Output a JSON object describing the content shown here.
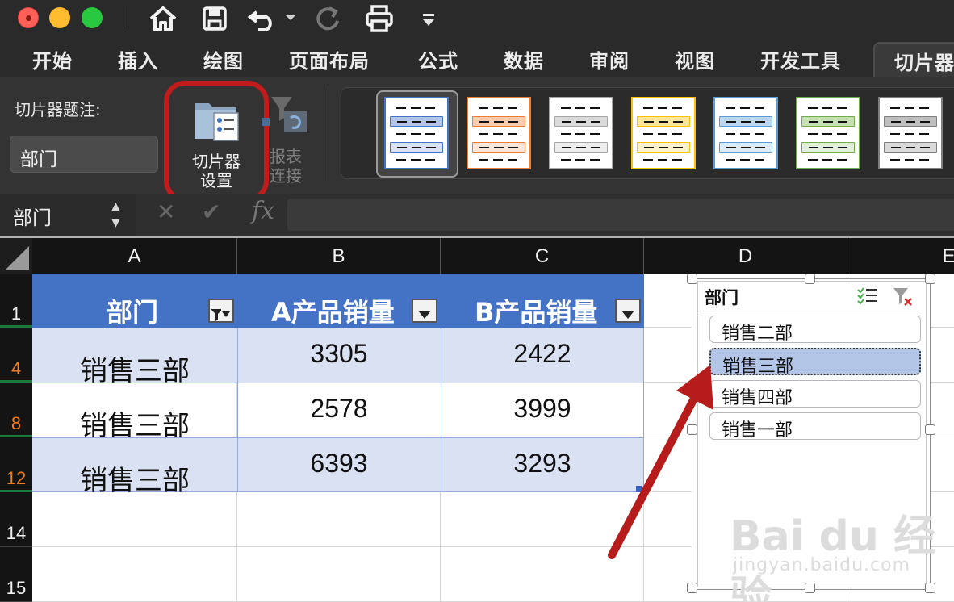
{
  "toolbar": {
    "icons": [
      "home-icon",
      "save-icon",
      "undo-icon",
      "redo-icon",
      "print-icon",
      "customize-icon"
    ]
  },
  "tabs": [
    "开始",
    "插入",
    "绘图",
    "页面布局",
    "公式",
    "数据",
    "审阅",
    "视图",
    "开发工具",
    "切片器"
  ],
  "ribbon": {
    "caption_label": "切片器题注:",
    "caption_value": "部门",
    "slicer_settings_line1": "切片器",
    "slicer_settings_line2": "设置",
    "report_conn_line1": "报表",
    "report_conn_line2": "连接"
  },
  "formula_bar": {
    "name_box": "部门",
    "fx": "fx"
  },
  "grid": {
    "columns": [
      "A",
      "B",
      "C",
      "D",
      "E"
    ],
    "row_numbers": [
      "1",
      "4",
      "8",
      "12",
      "14",
      "15"
    ],
    "headers": [
      "部门",
      "A产品销量",
      "B产品销量"
    ],
    "rows": [
      {
        "dept": "销售三部",
        "a": "3305",
        "b": "2422"
      },
      {
        "dept": "销售三部",
        "a": "2578",
        "b": "3999"
      },
      {
        "dept": "销售三部",
        "a": "6393",
        "b": "3293"
      }
    ]
  },
  "slicer": {
    "title": "部门",
    "items": [
      {
        "label": "销售二部",
        "selected": false
      },
      {
        "label": "销售三部",
        "selected": true
      },
      {
        "label": "销售四部",
        "selected": false
      },
      {
        "label": "销售一部",
        "selected": false
      }
    ]
  },
  "watermark": {
    "text": "Bai du 经验",
    "sub": "jingyan.baidu.com"
  },
  "colors": {
    "highlight": "#c11b1b",
    "table_header": "#4472c4",
    "band": "#d9e1f2",
    "selected_item": "#b4c6e7"
  }
}
